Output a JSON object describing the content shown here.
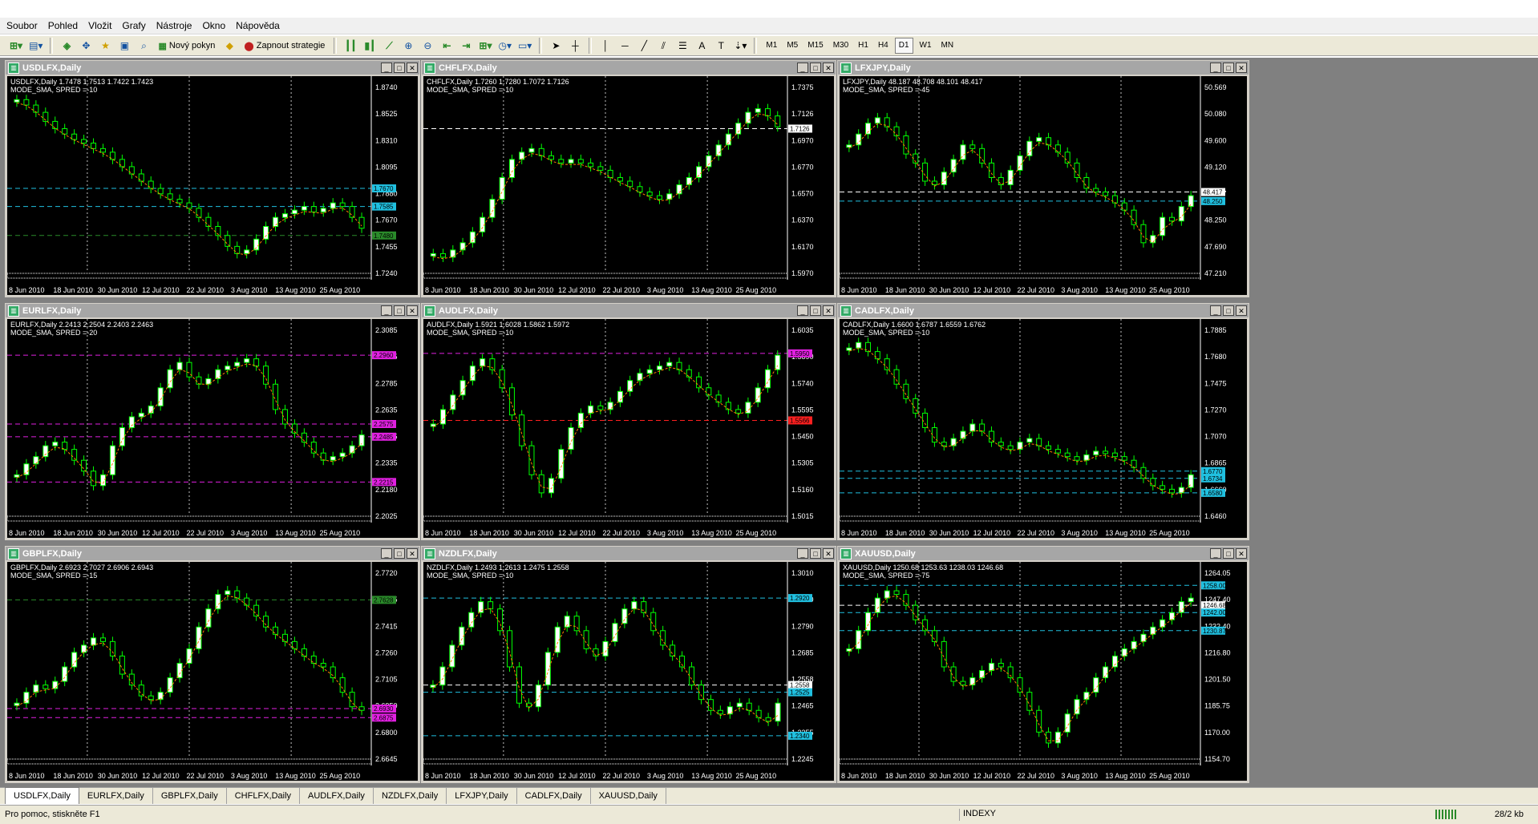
{
  "menu": [
    "Soubor",
    "Pohled",
    "Vložit",
    "Grafy",
    "Nástroje",
    "Okno",
    "Nápověda"
  ],
  "toolbar": {
    "new_order_label": "Nový pokyn",
    "strategies_label": "Zapnout strategie",
    "timeframes": [
      "M1",
      "M5",
      "M15",
      "M30",
      "H1",
      "H4",
      "D1",
      "W1",
      "MN"
    ],
    "active_timeframe": "D1"
  },
  "charts": [
    {
      "title": "USDLFX,Daily",
      "info1": "USDLFX,Daily  1.7478 1.7513 1.7422 1.7423",
      "info2": "MODE_SMA, SPRED =-10",
      "prices": [
        "1.8740",
        "1.8525",
        "1.8310",
        "1.8095",
        "1.7880",
        "1.7670",
        "1.7455",
        "1.7240"
      ],
      "tags": [
        {
          "label": "1.7670",
          "color": "#20c0e0",
          "val": 0.46
        },
        {
          "label": "1.7585",
          "color": "#20c0e0",
          "val": 0.36
        },
        {
          "label": "1.7480",
          "color": "#2a8a2a",
          "val": 0.2
        }
      ],
      "series": [
        0.95,
        0.92,
        0.88,
        0.83,
        0.79,
        0.76,
        0.73,
        0.71,
        0.68,
        0.66,
        0.62,
        0.58,
        0.54,
        0.5,
        0.46,
        0.43,
        0.4,
        0.38,
        0.35,
        0.3,
        0.25,
        0.2,
        0.14,
        0.1,
        0.12,
        0.18,
        0.25,
        0.3,
        0.32,
        0.34,
        0.36,
        0.33,
        0.35,
        0.38,
        0.36,
        0.3,
        0.24
      ]
    },
    {
      "title": "CHFLFX,Daily",
      "info1": "CHFLFX,Daily  1.7260 1.7280 1.7072 1.7126",
      "info2": "MODE_SMA, SPRED =-10",
      "prices": [
        "1.7375",
        "1.7126",
        "1.6970",
        "1.6770",
        "1.6570",
        "1.6370",
        "1.6170",
        "1.5970"
      ],
      "tags": [
        {
          "label": "1.7126",
          "color": "#ffffff",
          "val": 0.79
        }
      ],
      "series": [
        0.1,
        0.08,
        0.12,
        0.16,
        0.22,
        0.3,
        0.4,
        0.52,
        0.62,
        0.66,
        0.68,
        0.64,
        0.62,
        0.6,
        0.62,
        0.6,
        0.58,
        0.56,
        0.52,
        0.5,
        0.47,
        0.44,
        0.42,
        0.4,
        0.43,
        0.48,
        0.52,
        0.58,
        0.64,
        0.7,
        0.76,
        0.82,
        0.88,
        0.9,
        0.86,
        0.8
      ]
    },
    {
      "title": "LFXJPY,Daily",
      "info1": "LFXJPY,Daily  48.187 48.708 48.101 48.417",
      "info2": "MODE_SMA, SPRED =-45",
      "prices": [
        "50.569",
        "50.080",
        "49.600",
        "49.120",
        "48.417",
        "48.250",
        "47.690",
        "47.210"
      ],
      "tags": [
        {
          "label": "48.417",
          "color": "#ffffff",
          "val": 0.44
        },
        {
          "label": "48.250",
          "color": "#20c0e0",
          "val": 0.39
        }
      ],
      "series": [
        0.7,
        0.76,
        0.82,
        0.85,
        0.8,
        0.75,
        0.65,
        0.6,
        0.5,
        0.48,
        0.55,
        0.62,
        0.7,
        0.68,
        0.6,
        0.52,
        0.48,
        0.56,
        0.64,
        0.72,
        0.74,
        0.7,
        0.66,
        0.6,
        0.52,
        0.46,
        0.44,
        0.42,
        0.38,
        0.34,
        0.26,
        0.16,
        0.2,
        0.3,
        0.28,
        0.36,
        0.42
      ]
    },
    {
      "title": "EURLFX,Daily",
      "info1": "EURLFX,Daily  2.2413 2.2504 2.2403 2.2463",
      "info2": "MODE_SMA, SPRED =-20",
      "prices": [
        "2.3085",
        "2.2935",
        "2.2785",
        "2.2635",
        "2.2485",
        "2.2335",
        "2.2180",
        "2.2025"
      ],
      "tags": [
        {
          "label": "2.2960",
          "color": "#e020e0",
          "val": 0.88
        },
        {
          "label": "2.2575",
          "color": "#e020e0",
          "val": 0.5
        },
        {
          "label": "2.2485",
          "color": "#e020e0",
          "val": 0.43
        },
        {
          "label": "2.2215",
          "color": "#e020e0",
          "val": 0.18
        }
      ],
      "series": [
        0.22,
        0.28,
        0.32,
        0.38,
        0.4,
        0.36,
        0.3,
        0.24,
        0.16,
        0.22,
        0.38,
        0.48,
        0.54,
        0.56,
        0.6,
        0.7,
        0.8,
        0.84,
        0.76,
        0.72,
        0.75,
        0.8,
        0.82,
        0.84,
        0.86,
        0.82,
        0.72,
        0.58,
        0.5,
        0.45,
        0.4,
        0.34,
        0.3,
        0.32,
        0.34,
        0.38,
        0.44
      ]
    },
    {
      "title": "AUDLFX,Daily",
      "info1": "AUDLFX,Daily  1.5921 1.6028 1.5862 1.5972",
      "info2": "MODE_SMA, SPRED =-10",
      "prices": [
        "1.6035",
        "1.5890",
        "1.5740",
        "1.5595",
        "1.5450",
        "1.5305",
        "1.5160",
        "1.5015"
      ],
      "tags": [
        {
          "label": "1.5950",
          "color": "#e020e0",
          "val": 0.89
        },
        {
          "label": "1.5566",
          "color": "#ff2020",
          "val": 0.52
        }
      ],
      "series": [
        0.5,
        0.58,
        0.66,
        0.74,
        0.82,
        0.86,
        0.8,
        0.7,
        0.55,
        0.38,
        0.22,
        0.12,
        0.2,
        0.36,
        0.48,
        0.56,
        0.6,
        0.58,
        0.62,
        0.68,
        0.74,
        0.78,
        0.8,
        0.82,
        0.84,
        0.8,
        0.76,
        0.7,
        0.66,
        0.62,
        0.58,
        0.56,
        0.62,
        0.7,
        0.8,
        0.88
      ]
    },
    {
      "title": "CADLFX,Daily",
      "info1": "CADLFX,Daily  1.6600 1.6787 1.6559 1.6762",
      "info2": "MODE_SMA, SPRED =-10",
      "prices": [
        "1.7885",
        "1.7680",
        "1.7475",
        "1.7270",
        "1.7070",
        "1.6865",
        "1.6660",
        "1.6460"
      ],
      "tags": [
        {
          "label": "1.6770",
          "color": "#20c0e0",
          "val": 0.24
        },
        {
          "label": "1.6734",
          "color": "#20c0e0",
          "val": 0.2
        },
        {
          "label": "1.6580",
          "color": "#20c0e0",
          "val": 0.12
        }
      ],
      "series": [
        0.92,
        0.95,
        0.9,
        0.86,
        0.8,
        0.72,
        0.64,
        0.56,
        0.48,
        0.4,
        0.38,
        0.42,
        0.46,
        0.5,
        0.46,
        0.4,
        0.38,
        0.36,
        0.4,
        0.42,
        0.38,
        0.36,
        0.34,
        0.32,
        0.3,
        0.33,
        0.35,
        0.34,
        0.32,
        0.3,
        0.26,
        0.2,
        0.16,
        0.14,
        0.12,
        0.15,
        0.22
      ]
    },
    {
      "title": "GBPLFX,Daily",
      "info1": "GBPLFX,Daily  2.6923 2.7027 2.6906 2.6943",
      "info2": "MODE_SMA, SPRED =-15",
      "prices": [
        "2.7720",
        "2.7565",
        "2.7415",
        "2.7260",
        "2.7105",
        "2.6950",
        "2.6800",
        "2.6645"
      ],
      "tags": [
        {
          "label": "2.7628",
          "color": "#2a8a2a",
          "val": 0.87
        },
        {
          "label": "2.6930",
          "color": "#e020e0",
          "val": 0.27
        },
        {
          "label": "2.6875",
          "color": "#e020e0",
          "val": 0.22
        }
      ],
      "series": [
        0.3,
        0.36,
        0.4,
        0.38,
        0.42,
        0.5,
        0.58,
        0.62,
        0.66,
        0.64,
        0.56,
        0.46,
        0.4,
        0.34,
        0.32,
        0.36,
        0.44,
        0.52,
        0.6,
        0.72,
        0.82,
        0.9,
        0.92,
        0.88,
        0.84,
        0.78,
        0.72,
        0.68,
        0.64,
        0.6,
        0.56,
        0.52,
        0.5,
        0.44,
        0.36,
        0.28,
        0.26
      ]
    },
    {
      "title": "NZDLFX,Daily",
      "info1": "NZDLFX,Daily  1.2493 1.2613 1.2475 1.2558",
      "info2": "MODE_SMA, SPRED =-10",
      "prices": [
        "1.3010",
        "1.2920",
        "1.2790",
        "1.2685",
        "1.2558",
        "1.2465",
        "1.2355",
        "1.2245"
      ],
      "tags": [
        {
          "label": "1.2920",
          "color": "#20c0e0",
          "val": 0.88
        },
        {
          "label": "1.2558",
          "color": "#ffffff",
          "val": 0.4
        },
        {
          "label": "1.2525",
          "color": "#20c0e0",
          "val": 0.36
        },
        {
          "label": "1.2340",
          "color": "#20c0e0",
          "val": 0.12
        }
      ],
      "series": [
        0.4,
        0.5,
        0.62,
        0.72,
        0.8,
        0.86,
        0.82,
        0.7,
        0.5,
        0.3,
        0.28,
        0.4,
        0.58,
        0.72,
        0.78,
        0.7,
        0.6,
        0.56,
        0.64,
        0.74,
        0.82,
        0.86,
        0.8,
        0.7,
        0.62,
        0.56,
        0.5,
        0.4,
        0.32,
        0.26,
        0.24,
        0.28,
        0.3,
        0.26,
        0.22,
        0.2,
        0.3
      ]
    },
    {
      "title": "XAUUSD,Daily",
      "info1": "XAUUSD,Daily  1250.68 1253.63 1238.03 1246.68",
      "info2": "MODE_SMA, SPRED =-75",
      "prices": [
        "1264.05",
        "1247.40",
        "1232.40",
        "1216.80",
        "1201.50",
        "1185.75",
        "1170.00",
        "1154.70"
      ],
      "tags": [
        {
          "label": "1258.00",
          "color": "#20c0e0",
          "val": 0.95
        },
        {
          "label": "1246.68",
          "color": "#ffffff",
          "val": 0.84
        },
        {
          "label": "1242.00",
          "color": "#20c0e0",
          "val": 0.8
        },
        {
          "label": "1230.87",
          "color": "#20c0e0",
          "val": 0.7
        }
      ],
      "series": [
        0.6,
        0.7,
        0.8,
        0.88,
        0.92,
        0.9,
        0.84,
        0.76,
        0.7,
        0.64,
        0.5,
        0.42,
        0.4,
        0.44,
        0.48,
        0.52,
        0.5,
        0.44,
        0.36,
        0.26,
        0.14,
        0.08,
        0.14,
        0.24,
        0.32,
        0.36,
        0.44,
        0.5,
        0.56,
        0.6,
        0.64,
        0.68,
        0.72,
        0.76,
        0.8,
        0.86,
        0.88
      ]
    }
  ],
  "date_labels": [
    "8 Jun 2010",
    "18 Jun 2010",
    "30 Jun 2010",
    "12 Jul 2010",
    "22 Jul 2010",
    "3 Aug 2010",
    "13 Aug 2010",
    "25 Aug 2010"
  ],
  "tabs": [
    "USDLFX,Daily",
    "EURLFX,Daily",
    "GBPLFX,Daily",
    "CHFLFX,Daily",
    "AUDLFX,Daily",
    "NZDLFX,Daily",
    "LFXJPY,Daily",
    "CADLFX,Daily",
    "XAUUSD,Daily"
  ],
  "status": {
    "help": "Pro pomoc, stiskněte F1",
    "profile": "INDEXY",
    "traffic": "28/2 kb"
  }
}
